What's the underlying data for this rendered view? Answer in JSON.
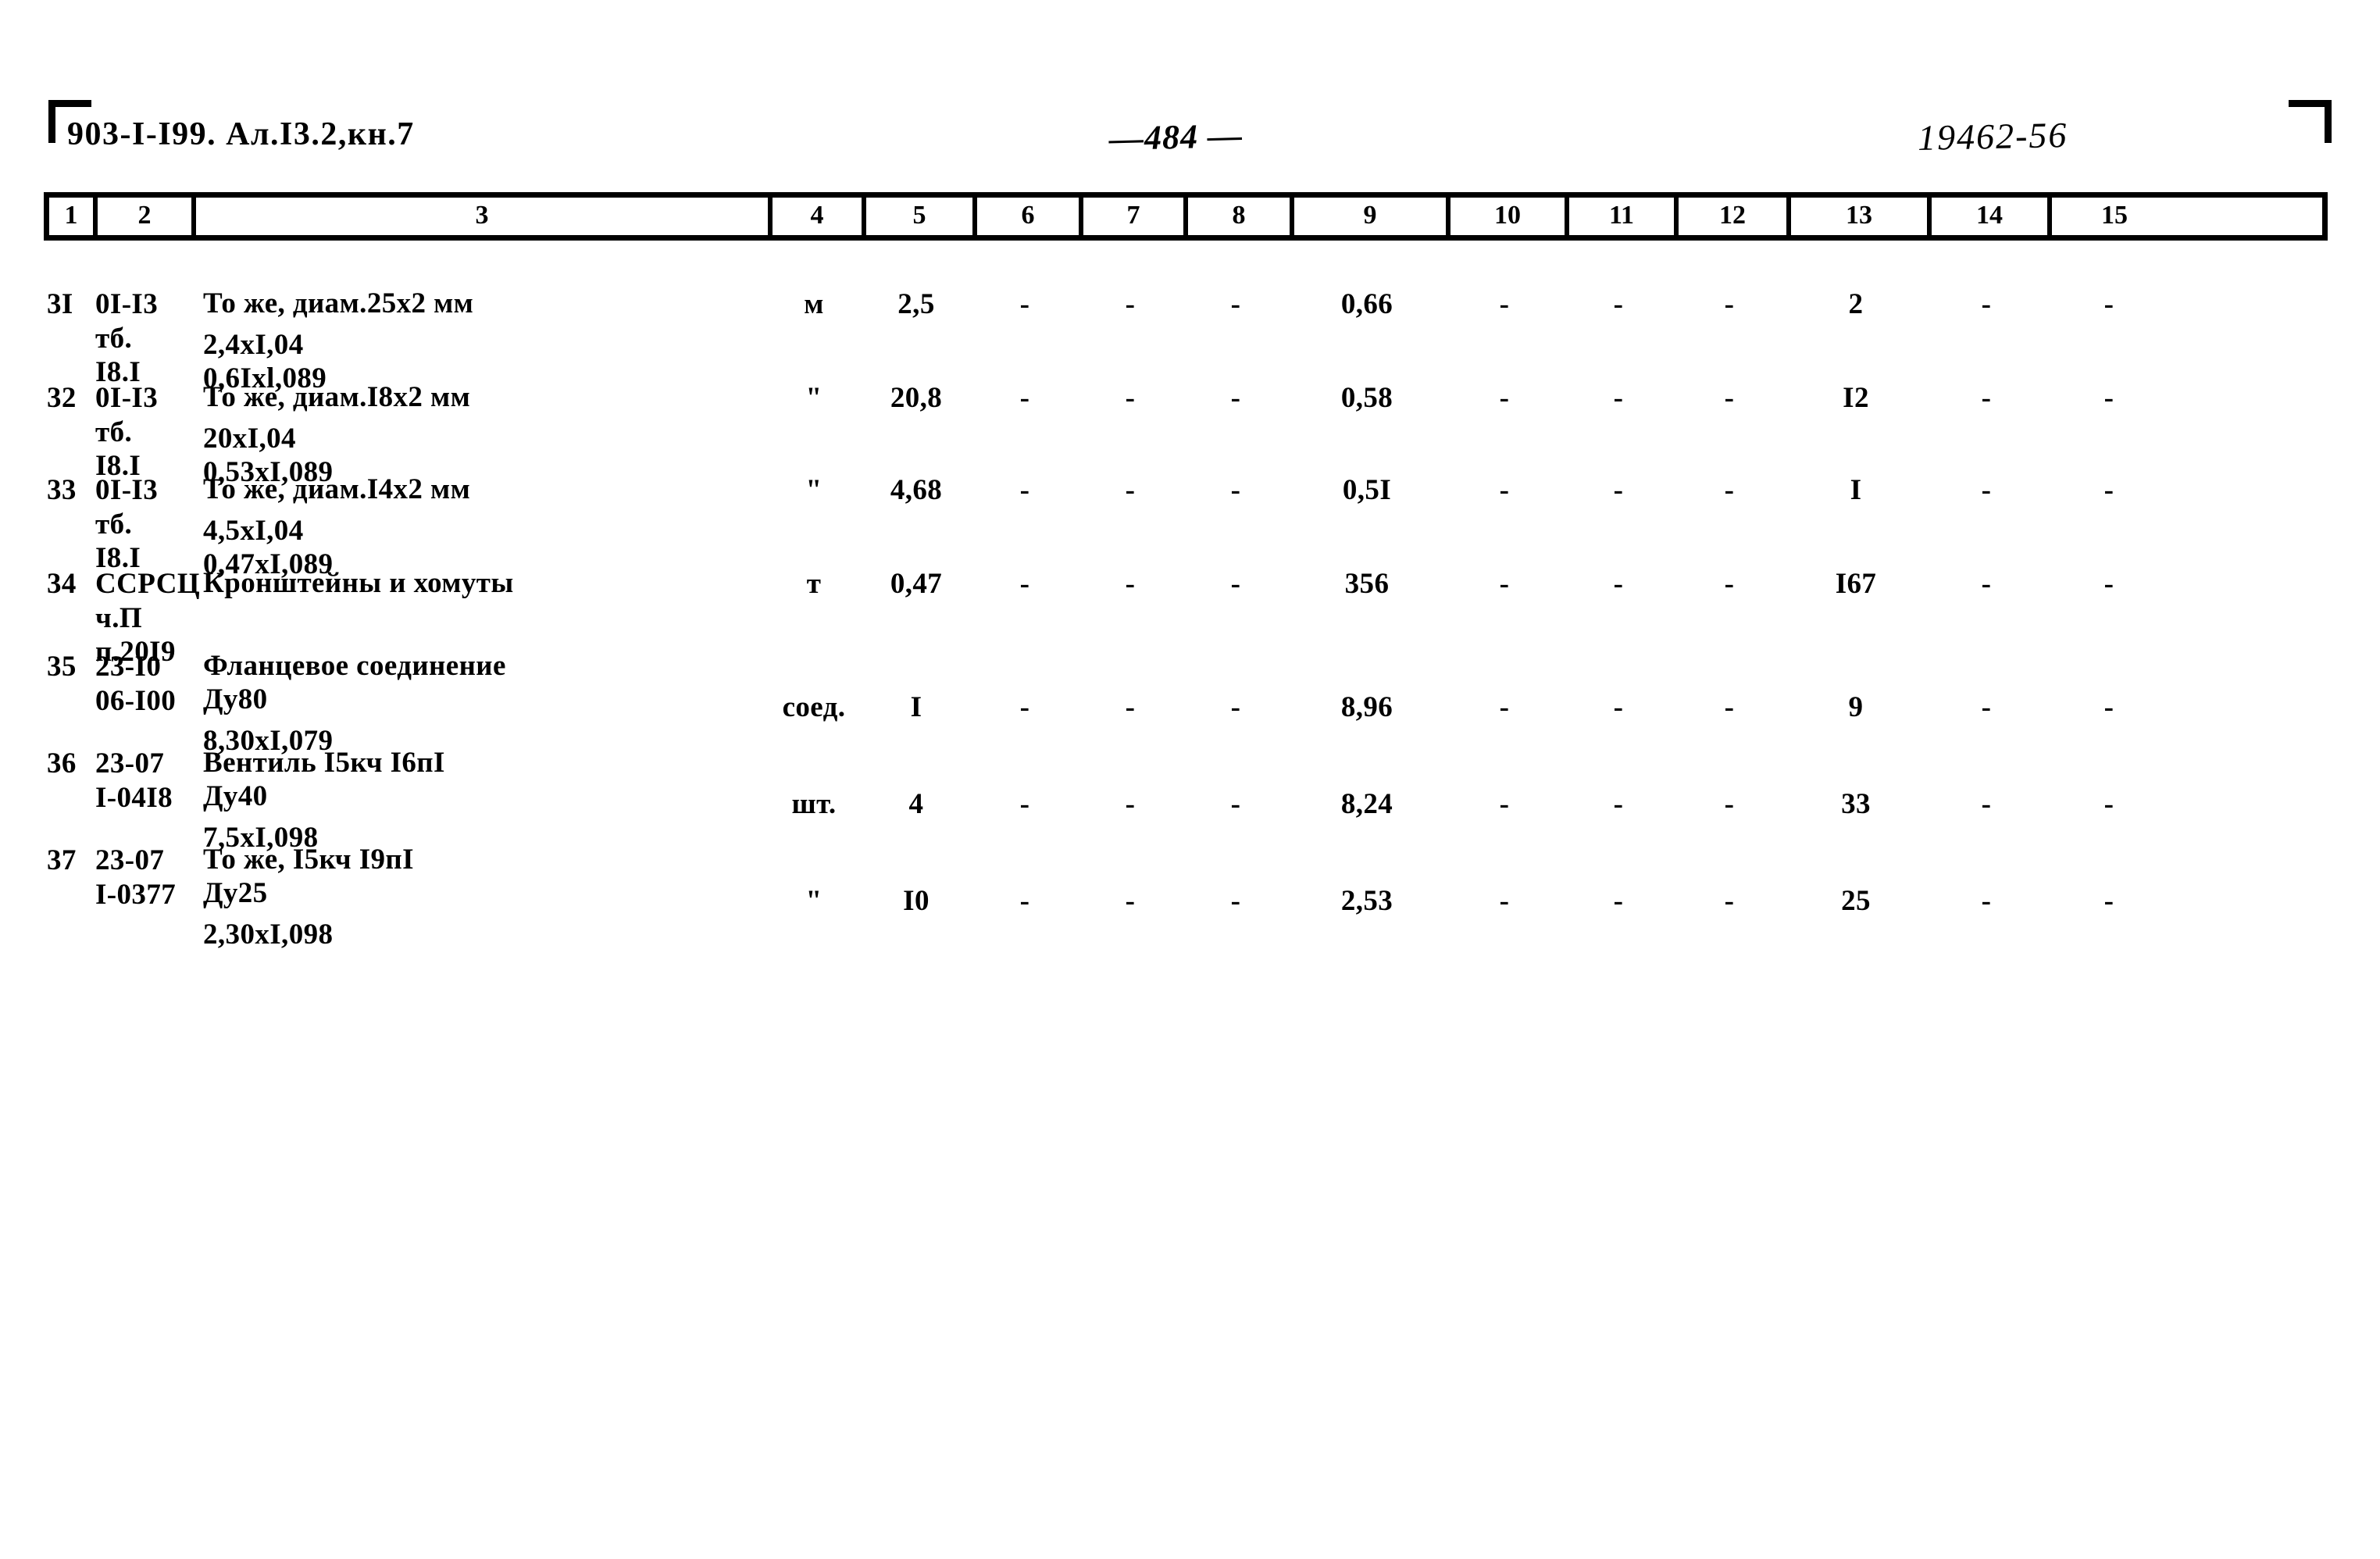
{
  "header": {
    "left_code": "903-I-I99. Ал.I3.2,кн.7",
    "page_number": "—484 —",
    "right_code": "19462-56"
  },
  "table": {
    "column_numbers": [
      "1",
      "2",
      "3",
      "4",
      "5",
      "6",
      "7",
      "8",
      "9",
      "10",
      "11",
      "12",
      "13",
      "14",
      "15"
    ],
    "rows": [
      {
        "num": "3I",
        "code": "0I-I3\nтб.\nI8.I",
        "desc": "То же, диам.25х2 мм",
        "desc_sub": "2,4хI,04\n0,6Iхl,089",
        "unit": "м",
        "qty": "2,5",
        "c6": "-",
        "c7": "-",
        "c8": "-",
        "c9": "0,66",
        "c10": "-",
        "c11": "-",
        "c12": "-",
        "c13": "2",
        "c14": "-",
        "c15": "-"
      },
      {
        "num": "32",
        "code": "0I-I3\nтб.\nI8.I",
        "desc": "То же, диам.I8х2 мм",
        "desc_sub": "20хI,04\n0,53хI,089",
        "unit": "\"",
        "qty": "20,8",
        "c6": "-",
        "c7": "-",
        "c8": "-",
        "c9": "0,58",
        "c10": "-",
        "c11": "-",
        "c12": "-",
        "c13": "I2",
        "c14": "-",
        "c15": "-"
      },
      {
        "num": "33",
        "code": "0I-I3\nтб.\nI8.I",
        "desc": "То же, диам.I4х2 мм",
        "desc_sub": "4,5хI,04\n0,47хI,089",
        "unit": "\"",
        "qty": "4,68",
        "c6": "-",
        "c7": "-",
        "c8": "-",
        "c9": "0,5I",
        "c10": "-",
        "c11": "-",
        "c12": "-",
        "c13": "I",
        "c14": "-",
        "c15": "-"
      },
      {
        "num": "34",
        "code": "ССРСЦ\nч.П\nп.20I9",
        "desc": "Кронштейны и хомуты",
        "desc_sub": "",
        "unit": "т",
        "qty": "0,47",
        "c6": "-",
        "c7": "-",
        "c8": "-",
        "c9": "356",
        "c10": "-",
        "c11": "-",
        "c12": "-",
        "c13": "I67",
        "c14": "-",
        "c15": "-"
      },
      {
        "num": "35",
        "code": "23-I0\n06-I00",
        "desc": "Фланцевое соединение\nДу80",
        "desc_sub": "8,30хI,079",
        "unit": "соед.",
        "qty": "I",
        "c6": "-",
        "c7": "-",
        "c8": "-",
        "c9": "8,96",
        "c10": "-",
        "c11": "-",
        "c12": "-",
        "c13": "9",
        "c14": "-",
        "c15": "-"
      },
      {
        "num": "36",
        "code": "23-07\nI-04I8",
        "desc": "Вентиль I5кч I6пI\nДу40",
        "desc_sub": "7,5хI,098",
        "unit": "шт.",
        "qty": "4",
        "c6": "-",
        "c7": "-",
        "c8": "-",
        "c9": "8,24",
        "c10": "-",
        "c11": "-",
        "c12": "-",
        "c13": "33",
        "c14": "-",
        "c15": "-"
      },
      {
        "num": "37",
        "code": "23-07\nI-0377",
        "desc": "То же, I5кч I9пI\nДу25",
        "desc_sub": "2,30хI,098",
        "unit": "\"",
        "qty": "I0",
        "c6": "-",
        "c7": "-",
        "c8": "-",
        "c9": "2,53",
        "c10": "-",
        "c11": "-",
        "c12": "-",
        "c13": "25",
        "c14": "-",
        "c15": "-"
      }
    ]
  }
}
